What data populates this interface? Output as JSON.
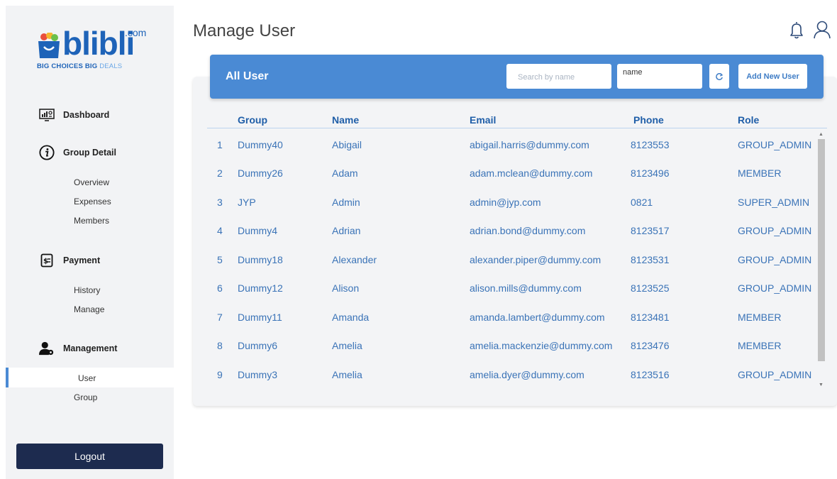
{
  "brand": {
    "name": "blibli",
    "suffix": ".com",
    "tagline_strong": "BIG CHOICES  BIG",
    "tagline_light": "DEALS"
  },
  "sidebar": {
    "dashboard": "Dashboard",
    "group_detail": {
      "label": "Group Detail",
      "items": [
        "Overview",
        "Expenses",
        "Members"
      ]
    },
    "payment": {
      "label": "Payment",
      "items": [
        "History",
        "Manage"
      ]
    },
    "management": {
      "label": "Management",
      "items": [
        "User",
        "Group"
      ]
    },
    "logout": "Logout"
  },
  "header": {
    "title": "Manage User"
  },
  "panel": {
    "title": "All User",
    "search_placeholder": "Search by name",
    "filter_field": "name",
    "add_button": "Add New User"
  },
  "table": {
    "columns": [
      "Group",
      "Name",
      "Email",
      "Phone",
      "Role"
    ],
    "rows": [
      {
        "no": "1",
        "group": "Dummy40",
        "name": "Abigail",
        "email": "abigail.harris@dummy.com",
        "phone": "8123553",
        "role": "GROUP_ADMIN"
      },
      {
        "no": "2",
        "group": "Dummy26",
        "name": "Adam",
        "email": "adam.mclean@dummy.com",
        "phone": "8123496",
        "role": "MEMBER"
      },
      {
        "no": "3",
        "group": "JYP",
        "name": "Admin",
        "email": "admin@jyp.com",
        "phone": "0821",
        "role": "SUPER_ADMIN"
      },
      {
        "no": "4",
        "group": "Dummy4",
        "name": "Adrian",
        "email": "adrian.bond@dummy.com",
        "phone": "8123517",
        "role": "GROUP_ADMIN"
      },
      {
        "no": "5",
        "group": "Dummy18",
        "name": "Alexander",
        "email": "alexander.piper@dummy.com",
        "phone": "8123531",
        "role": "GROUP_ADMIN"
      },
      {
        "no": "6",
        "group": "Dummy12",
        "name": "Alison",
        "email": "alison.mills@dummy.com",
        "phone": "8123525",
        "role": "GROUP_ADMIN"
      },
      {
        "no": "7",
        "group": "Dummy11",
        "name": "Amanda",
        "email": "amanda.lambert@dummy.com",
        "phone": "8123481",
        "role": "MEMBER"
      },
      {
        "no": "8",
        "group": "Dummy6",
        "name": "Amelia",
        "email": "amelia.mackenzie@dummy.com",
        "phone": "8123476",
        "role": "MEMBER"
      },
      {
        "no": "9",
        "group": "Dummy3",
        "name": "Amelia",
        "email": "amelia.dyer@dummy.com",
        "phone": "8123516",
        "role": "GROUP_ADMIN"
      }
    ]
  },
  "colors": {
    "accent": "#4a8ad4",
    "text_link": "#3a73b7",
    "header_text": "#1f5ea8",
    "logout_bg": "#1d2b4f"
  },
  "icons": {
    "header": [
      "bell-icon",
      "user-icon"
    ],
    "nav": [
      "dashboard-icon",
      "info-icon",
      "payment-icon",
      "management-icon"
    ],
    "panel": [
      "refresh-icon"
    ]
  }
}
